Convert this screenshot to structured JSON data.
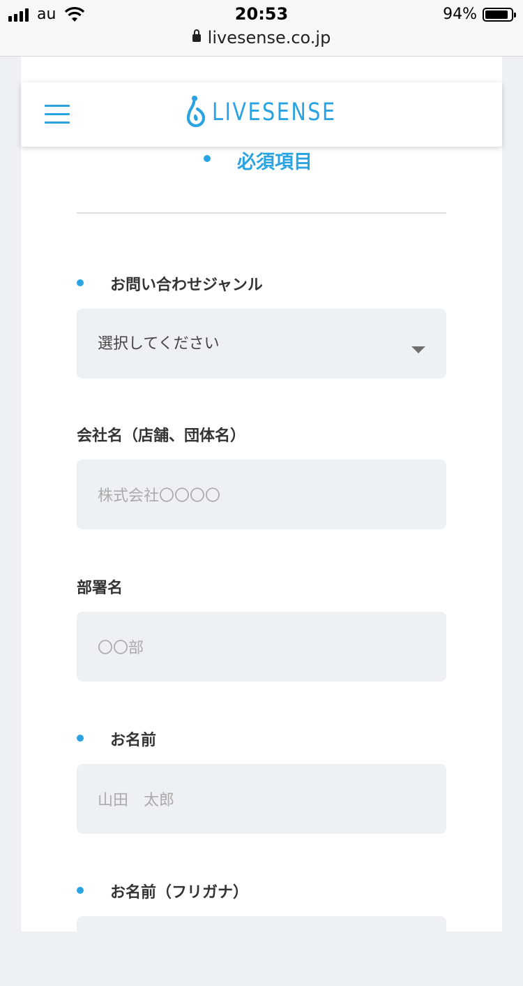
{
  "status_bar": {
    "carrier": "au",
    "time": "20:53",
    "battery": "94%",
    "battery_level": 0.94,
    "url": "livesense.co.jp"
  },
  "header": {
    "logo_text": "LIVESENSE",
    "brand_color": "#2aa3e2"
  },
  "legend": {
    "required_label": "必須項目"
  },
  "form": {
    "genre": {
      "label": "お問い合わせジャンル",
      "required": true,
      "selected": "選択してください"
    },
    "company": {
      "label": "会社名（店舗、団体名）",
      "required": false,
      "placeholder": "株式会社〇〇〇〇"
    },
    "department": {
      "label": "部署名",
      "required": false,
      "placeholder": "〇〇部"
    },
    "name": {
      "label": "お名前",
      "required": true,
      "placeholder": "山田　太郎"
    },
    "name_kana": {
      "label": "お名前（フリガナ）",
      "required": true,
      "placeholder": ""
    }
  }
}
